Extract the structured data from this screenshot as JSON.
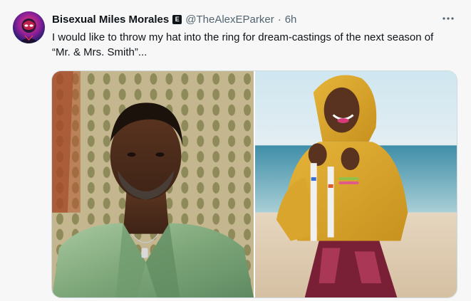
{
  "author": {
    "display_name": "Bisexual Miles Morales",
    "badge_label": "E",
    "handle": "@TheAlexEParker",
    "separator": "·",
    "timestamp": "6h"
  },
  "tweet": {
    "text": "I would like to throw my hat into the ring for dream-castings of the next season of “Mr. & Mrs. Smith”..."
  },
  "icons": {
    "more": "more-horizontal-icon",
    "badge": "affiliate-badge-icon"
  },
  "media": {
    "left_photo": "photo of a man in a green silk shirt",
    "right_photo": "photo of a woman in a yellow hoodie on a beach"
  },
  "colors": {
    "background": "#f7f7f7",
    "text_primary": "#0f1419",
    "text_secondary": "#536471"
  }
}
